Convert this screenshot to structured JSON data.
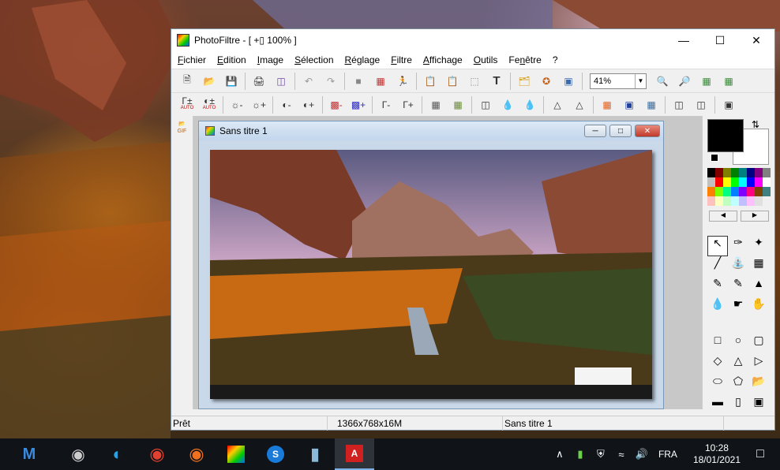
{
  "window": {
    "title": "PhotoFiltre - [ +▯ 100% ]"
  },
  "menu": [
    {
      "label": "Fichier",
      "ul": "F"
    },
    {
      "label": "Edition",
      "ul": "E"
    },
    {
      "label": "Image",
      "ul": "I"
    },
    {
      "label": "Sélection",
      "ul": "S"
    },
    {
      "label": "Réglage",
      "ul": "R"
    },
    {
      "label": "Filtre",
      "ul": "F"
    },
    {
      "label": "Affichage",
      "ul": "A"
    },
    {
      "label": "Outils",
      "ul": "O"
    },
    {
      "label": "Fenêtre",
      "ul": "n"
    },
    {
      "label": "?",
      "ul": ""
    }
  ],
  "toolbar": {
    "zoom_value": "41%"
  },
  "toolbar2": {
    "auto_label_1": "AUTO",
    "auto_label_2": "AUTO"
  },
  "document": {
    "title": "Sans titre 1"
  },
  "statusbar": {
    "state": "Prêt",
    "dimensions": "1366x768x16M",
    "doc_name": "Sans titre 1"
  },
  "taskbar": {
    "language": "FRA",
    "time": "10:28",
    "date": "18/01/2021"
  },
  "colors": {
    "foreground": "#000000",
    "background": "#ffffff"
  }
}
